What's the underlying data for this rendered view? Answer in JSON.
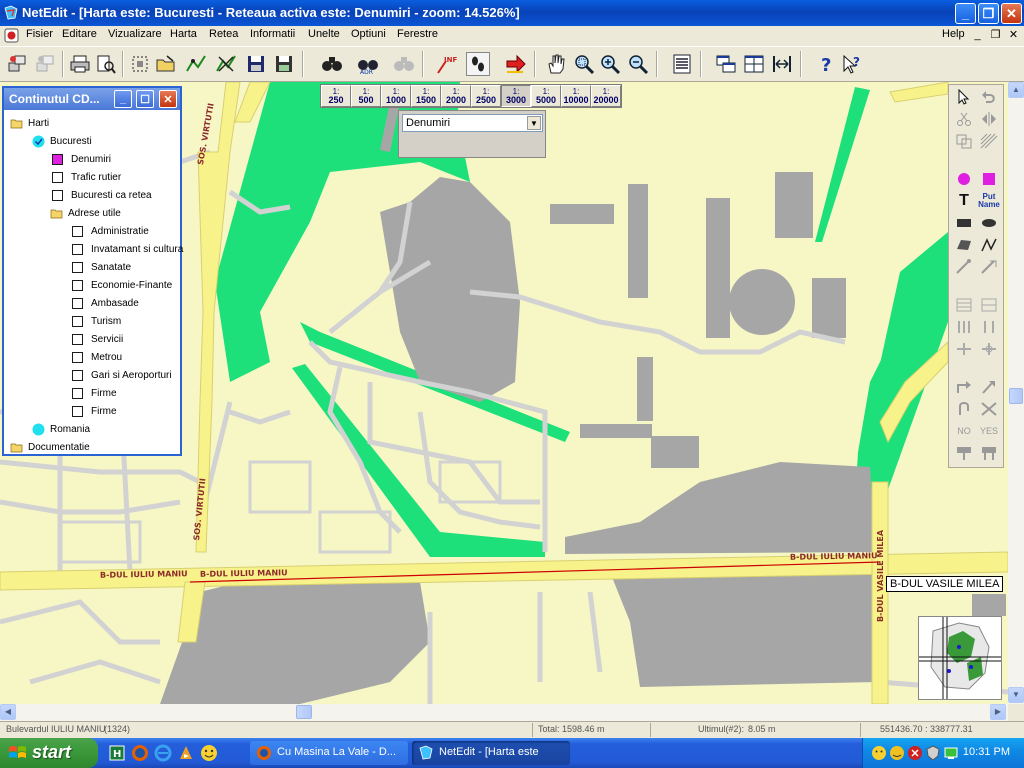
{
  "window": {
    "title": "NetEdit - [Harta este:  Bucuresti - Reteaua activa este:  Denumiri  - zoom: 14.526%]"
  },
  "menu": {
    "items": [
      "Fisier",
      "Editare",
      "Vizualizare",
      "Harta",
      "Retea",
      "Informatii",
      "Unelte",
      "Optiuni",
      "Ferestre",
      "Help"
    ]
  },
  "toolbar": {
    "icons": [
      "layers-icon",
      "layers-disabled-icon",
      "print-icon",
      "print-preview-icon",
      "select-region-icon",
      "open-folder-icon",
      "route-icon",
      "route-cross-icon",
      "save-icon",
      "save-as-icon",
      "find-icon",
      "find-address-icon",
      "find-disabled-icon",
      "info-icon",
      "footprints-icon",
      "go-arrow-icon",
      "pan-hand-icon",
      "zoom-window-icon",
      "zoom-in-icon",
      "zoom-out-icon",
      "calculator-icon",
      "cascade-windows-icon",
      "tile-windows-icon",
      "fit-width-icon",
      "help-icon",
      "context-help-icon"
    ]
  },
  "scale_bar": {
    "items": [
      {
        "top": "1:",
        "bottom": "250"
      },
      {
        "top": "1:",
        "bottom": "500"
      },
      {
        "top": "1:",
        "bottom": "1000"
      },
      {
        "top": "1:",
        "bottom": "1500"
      },
      {
        "top": "1:",
        "bottom": "2000"
      },
      {
        "top": "1:",
        "bottom": "2500"
      },
      {
        "top": "1:",
        "bottom": "3000"
      },
      {
        "top": "1:",
        "bottom": "5000"
      },
      {
        "top": "1:",
        "bottom": "10000"
      },
      {
        "top": "1:",
        "bottom": "20000"
      }
    ]
  },
  "layer_select": {
    "value": "Denumiri"
  },
  "map": {
    "street_labels": {
      "sos_virtutii_top": "SOS. VIRTUTII",
      "sos_virtutii_bottom": "SOS. VIRTUTII",
      "iuliu_maniu_left_1": "B-DUL IULIU MANIU",
      "iuliu_maniu_left_2": "B-DUL IULIU MANIU",
      "iuliu_maniu_right": "B-DUL IULIU MANIU",
      "vasile_milea_vertical": "B-DUL VASILE MILEA"
    },
    "tooltip": "B-DUL VASILE MILEA",
    "palette_text": {
      "text_tool": "T",
      "put_name": "Put Name",
      "no_label": "NO",
      "yes_label": "YES"
    }
  },
  "tree_panel": {
    "title": "Continutul CD...",
    "items": [
      {
        "label": "Harti",
        "icon": "folder-open-icon"
      },
      {
        "label": "Bucuresti",
        "icon": "check-circle-icon"
      },
      {
        "label": "Denumiri",
        "icon": "checkbox-checked-icon"
      },
      {
        "label": "Trafic rutier",
        "icon": "checkbox-icon"
      },
      {
        "label": "Bucuresti ca retea",
        "icon": "checkbox-icon"
      },
      {
        "label": "Adrese utile",
        "icon": "folder-open-icon"
      },
      {
        "label": "Administratie",
        "icon": "checkbox-icon"
      },
      {
        "label": "Invatamant si cultura",
        "icon": "checkbox-icon"
      },
      {
        "label": "Sanatate",
        "icon": "checkbox-icon"
      },
      {
        "label": "Economie-Finante",
        "icon": "checkbox-icon"
      },
      {
        "label": "Ambasade",
        "icon": "checkbox-icon"
      },
      {
        "label": "Turism",
        "icon": "checkbox-icon"
      },
      {
        "label": "Servicii",
        "icon": "checkbox-icon"
      },
      {
        "label": "Metrou",
        "icon": "checkbox-icon"
      },
      {
        "label": "Gari si Aeroporturi",
        "icon": "checkbox-icon"
      },
      {
        "label": "Firme",
        "icon": "checkbox-icon"
      },
      {
        "label": "Firme",
        "icon": "checkbox-icon"
      },
      {
        "label": "Romania",
        "icon": "circle-icon"
      },
      {
        "label": "Documentatie",
        "icon": "folder-icon"
      }
    ]
  },
  "status_bar": {
    "street": "Bulevardul IULIU MANIU",
    "street_code": "(1324)",
    "total": "Total:  1598.46 m",
    "last": "Ultimul(#2):",
    "last_value": "8.05 m",
    "coords": "551436.70 : 338777.31"
  },
  "taskbar": {
    "start_label": "start",
    "tasks": [
      {
        "label": "Cu Masina La Vale - D..."
      },
      {
        "label": "NetEdit - [Harta este"
      }
    ],
    "clock": "10:31 PM"
  },
  "colors": {
    "map_background": "#f7f7c6",
    "park_green": "#1ee07a",
    "building_gray": "#a6a6a6",
    "road_gray": "#d2d2d2",
    "boulevard_yellow": "#f8f28a",
    "route_red": "#cc0000",
    "title_blue": "#0842b8",
    "taskbar_blue": "#245edb"
  }
}
